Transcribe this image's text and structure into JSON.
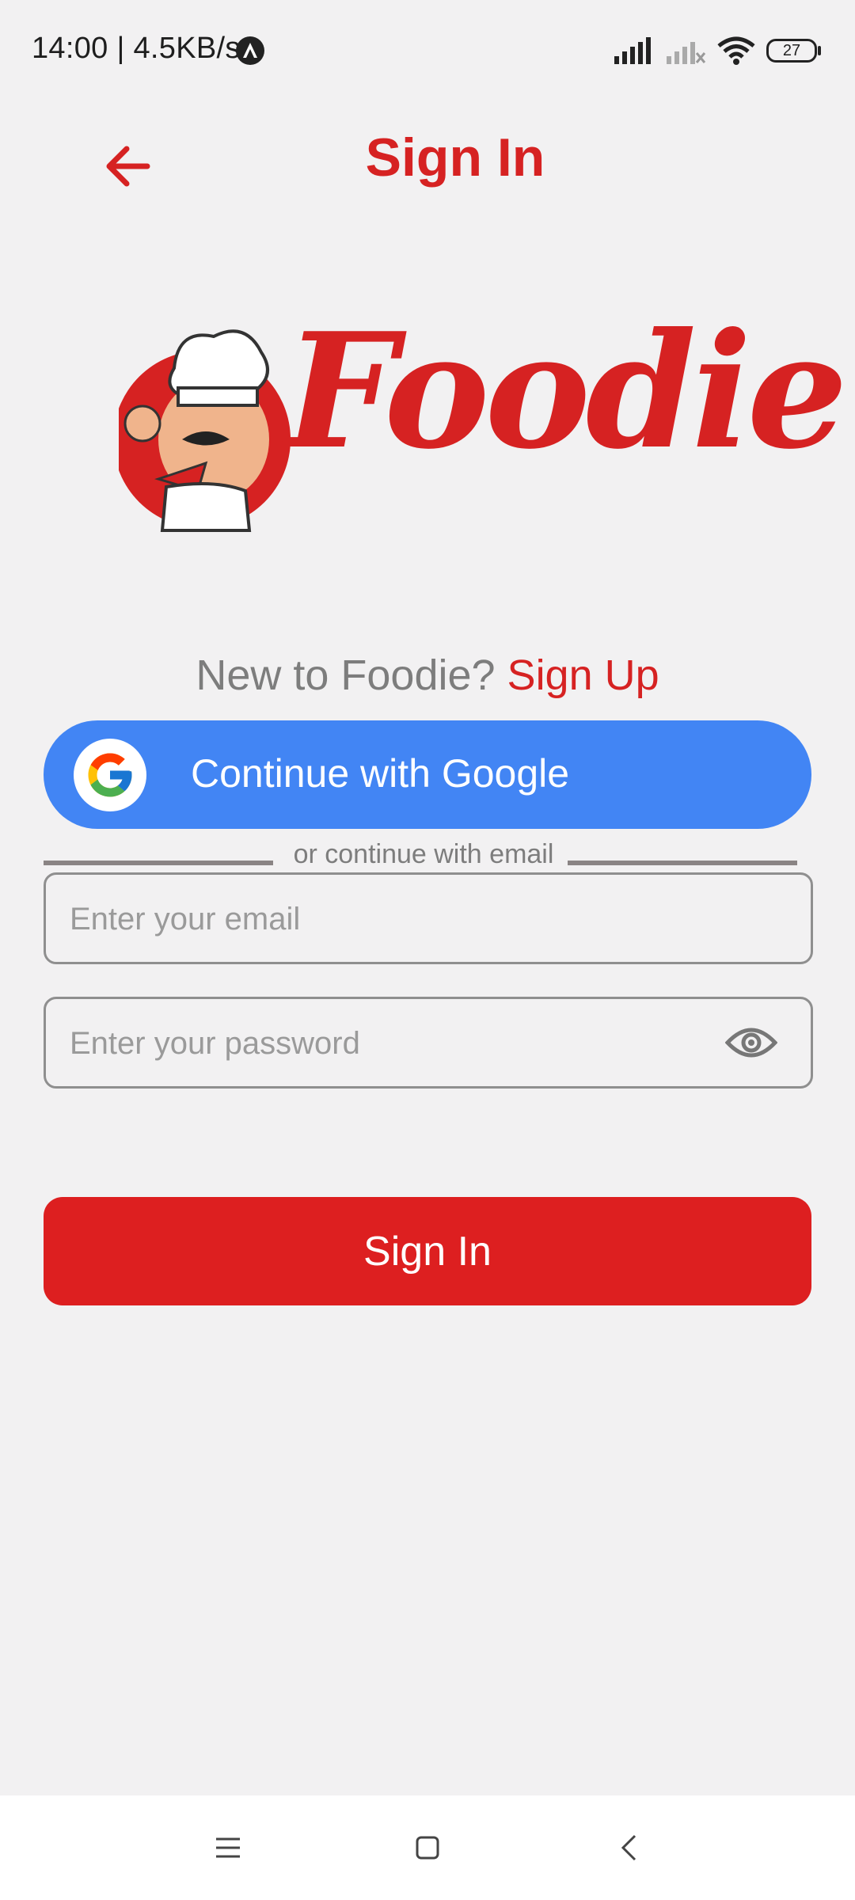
{
  "status_bar": {
    "time_speed": "14:00 | 4.5KB/s",
    "battery": "27"
  },
  "header": {
    "title": "Sign In",
    "back_icon": "arrow-left-icon"
  },
  "logo": {
    "brand": "Foodie",
    "mascot_icon": "chef-mascot-icon"
  },
  "signup_prompt": {
    "text": "New to Foodie? ",
    "link": "Sign Up"
  },
  "google": {
    "label": "Continue with Google",
    "icon": "google-g-icon"
  },
  "divider": {
    "text": "or continue with email"
  },
  "email": {
    "placeholder": "Enter your email",
    "value": ""
  },
  "password": {
    "placeholder": "Enter your password",
    "value": "",
    "toggle_icon": "eye-icon"
  },
  "submit": {
    "label": "Sign In"
  },
  "colors": {
    "brand_red": "#d62222",
    "button_red": "#dd1f20",
    "google_blue": "#4285f4",
    "background": "#f2f1f2"
  },
  "nav": {
    "menu_icon": "menu-icon",
    "home_icon": "home-square-icon",
    "back_icon": "back-chevron-icon"
  }
}
